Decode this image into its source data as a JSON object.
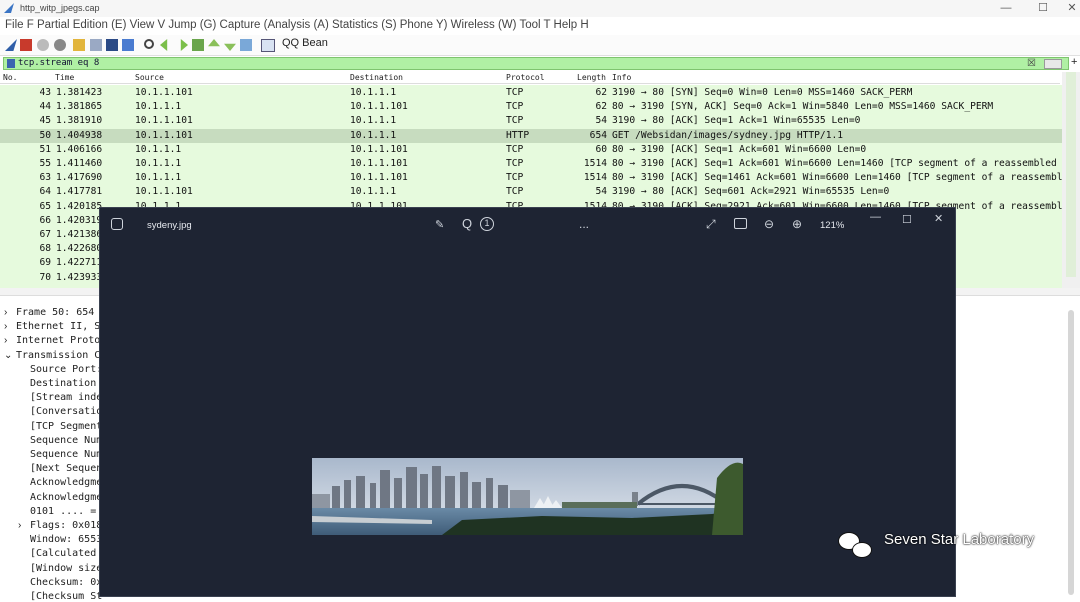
{
  "window": {
    "title": "http_witp_jpegs.cap"
  },
  "menu": {
    "text": "File F Partial Edition (E) View V Jump (G) Capture (Analysis (A) Statistics (S) Phone Y) Wireless (W) Tool T Help H"
  },
  "toolbar": {
    "label": "QQ Bean"
  },
  "filter": {
    "value": "tcp.stream eq 8"
  },
  "columns": [
    "No.",
    "Time",
    "Source",
    "Destination",
    "Protocol",
    "Length",
    "Info"
  ],
  "packets": [
    {
      "no": "43",
      "time": "1.381423",
      "src": "10.1.1.101",
      "dst": "10.1.1.1",
      "proto": "TCP",
      "len": "62",
      "info": "3190 → 80 [SYN] Seq=0 Win=0 Len=0 MSS=1460 SACK_PERM"
    },
    {
      "no": "44",
      "time": "1.381865",
      "src": "10.1.1.1",
      "dst": "10.1.1.101",
      "proto": "TCP",
      "len": "62",
      "info": "80 → 3190 [SYN, ACK] Seq=0 Ack=1 Win=5840 Len=0 MSS=1460 SACK_PERM"
    },
    {
      "no": "45",
      "time": "1.381910",
      "src": "10.1.1.101",
      "dst": "10.1.1.1",
      "proto": "TCP",
      "len": "54",
      "info": "3190 → 80 [ACK] Seq=1 Ack=1 Win=65535 Len=0"
    },
    {
      "no": "50",
      "time": "1.404938",
      "src": "10.1.1.101",
      "dst": "10.1.1.1",
      "proto": "HTTP",
      "len": "654",
      "info": "GET /Websidan/images/sydney.jpg HTTP/1.1"
    },
    {
      "no": "51",
      "time": "1.406166",
      "src": "10.1.1.1",
      "dst": "10.1.1.101",
      "proto": "TCP",
      "len": "60",
      "info": "80 → 3190 [ACK] Seq=1 Ack=601 Win=6600 Len=0"
    },
    {
      "no": "55",
      "time": "1.411460",
      "src": "10.1.1.1",
      "dst": "10.1.1.101",
      "proto": "TCP",
      "len": "1514",
      "info": "80 → 3190 [ACK] Seq=1 Ack=601 Win=6600 Len=1460 [TCP segment of a reassembled PDU]"
    },
    {
      "no": "63",
      "time": "1.417690",
      "src": "10.1.1.1",
      "dst": "10.1.1.101",
      "proto": "TCP",
      "len": "1514",
      "info": "80 → 3190 [ACK] Seq=1461 Ack=601 Win=6600 Len=1460 [TCP segment of a reassembled PDU]"
    },
    {
      "no": "64",
      "time": "1.417781",
      "src": "10.1.1.101",
      "dst": "10.1.1.1",
      "proto": "TCP",
      "len": "54",
      "info": "3190 → 80 [ACK] Seq=601 Ack=2921 Win=65535 Len=0"
    },
    {
      "no": "65",
      "time": "1.420185",
      "src": "10.1.1.1",
      "dst": "10.1.1.101",
      "proto": "TCP",
      "len": "1514",
      "info": "80 → 3190 [ACK] Seq=2921 Ack=601 Win=6600 Len=1460 [TCP segment of a reassembled PDU]"
    },
    {
      "no": "66",
      "time": "1.420319",
      "src": "",
      "dst": "",
      "proto": "",
      "len": "",
      "info": "ent of a reassemble"
    },
    {
      "no": "67",
      "time": "1.421386",
      "src": "",
      "dst": "",
      "proto": "",
      "len": "",
      "info": "ent of a reassemble"
    },
    {
      "no": "68",
      "time": "1.422680",
      "src": "",
      "dst": "",
      "proto": "",
      "len": "",
      "info": "ent of a reassemble"
    },
    {
      "no": "69",
      "time": "1.422711",
      "src": "",
      "dst": "",
      "proto": "",
      "len": "",
      "info": ""
    },
    {
      "no": "70",
      "time": "1.423933",
      "src": "",
      "dst": "",
      "proto": "",
      "len": "",
      "info": "ent of a reassemble"
    }
  ],
  "details": [
    "Frame 50: 654 b",
    "Ethernet II, Sr",
    "Internet Protoc",
    "Transmission Co",
    "Source Port:",
    "Destination",
    "[Stream inde",
    "[Conversatio",
    "[TCP Segment",
    "Sequence Num",
    "Sequence Num",
    "[Next Sequen",
    "Acknowledgme",
    "Acknowledgme",
    "0101 .... =",
    "Flags: 0x018",
    "Window: 6553",
    "[Calculated",
    "[Window size",
    "Checksum: 0x",
    "[Checksum St"
  ],
  "viewer": {
    "filename": "sydeny.jpg",
    "zoom": "121%",
    "more": "..."
  },
  "watermark": {
    "text": "Seven Star Laboratory"
  }
}
